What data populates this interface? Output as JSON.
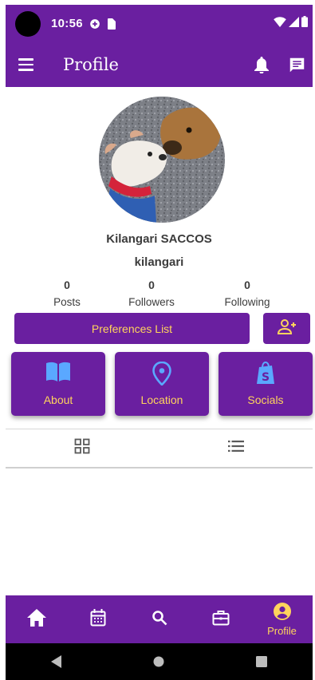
{
  "status_bar": {
    "time": "10:56",
    "icons": [
      "camera-hole",
      "data-saver-icon",
      "sim-icon",
      "wifi-icon",
      "signal-icon",
      "battery-icon"
    ]
  },
  "app_bar": {
    "title": "Profile",
    "icons": [
      "menu-icon",
      "bell-icon",
      "chat-icon"
    ]
  },
  "profile": {
    "name": "Kilangari SACCOS",
    "handle": "kilangari",
    "stats": [
      {
        "value": "0",
        "label": "Posts"
      },
      {
        "value": "0",
        "label": "Followers"
      },
      {
        "value": "0",
        "label": "Following"
      }
    ]
  },
  "actions": {
    "preferences_label": "Preferences List",
    "add_user_icon": "person-add-icon"
  },
  "cards": [
    {
      "label": "About",
      "icon": "book-icon"
    },
    {
      "label": "Location",
      "icon": "location-pin-icon"
    },
    {
      "label": "Socials",
      "icon": "shopify-bag-icon"
    }
  ],
  "tabs": [
    {
      "icon": "grid-icon"
    },
    {
      "icon": "list-icon"
    }
  ],
  "bottom_nav": {
    "items": [
      {
        "icon": "home-icon",
        "label": ""
      },
      {
        "icon": "calendar-icon",
        "label": ""
      },
      {
        "icon": "search-icon",
        "label": ""
      },
      {
        "icon": "briefcase-icon",
        "label": ""
      },
      {
        "icon": "account-circle-icon",
        "label": "Profile",
        "active": true
      }
    ]
  },
  "system_nav": [
    "back-icon",
    "home-circle-icon",
    "recents-icon"
  ],
  "colors": {
    "primary": "#6a1fa0",
    "accent": "#ffd45c",
    "card_icon": "#5aa8ff",
    "text": "#3c3c3c"
  }
}
